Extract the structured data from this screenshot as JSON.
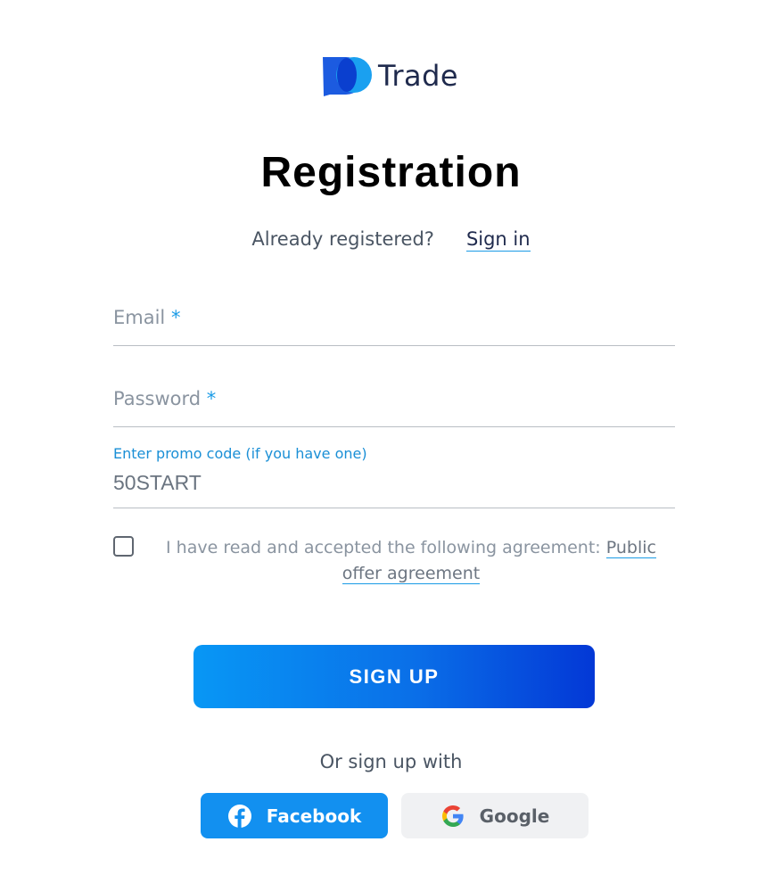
{
  "brand": {
    "name": "Trade",
    "logo_icon": "po-logo-icon"
  },
  "page": {
    "title": "Registration"
  },
  "signin_prompt": {
    "text": "Already registered?",
    "link": "Sign in"
  },
  "form": {
    "email": {
      "label": "Email",
      "required_mark": "*",
      "value": ""
    },
    "password": {
      "label": "Password",
      "required_mark": "*",
      "value": ""
    },
    "promo": {
      "label": "Enter promo code (if you have one)",
      "value": "50START"
    },
    "agreement": {
      "checked": false,
      "text": "I have read and accepted the following agreement:",
      "link": "Public offer agreement"
    },
    "submit_label": "SIGN UP"
  },
  "social": {
    "prompt": "Or sign up with",
    "buttons": [
      {
        "label": "Facebook",
        "icon": "facebook-icon"
      },
      {
        "label": "Google",
        "icon": "google-icon"
      }
    ]
  },
  "colors": {
    "accent": "#1a9be6",
    "button_gradient_start": "#0897f5",
    "button_gradient_end": "#0338d6",
    "facebook": "#1290f0",
    "google_bg": "#f0f1f3"
  }
}
